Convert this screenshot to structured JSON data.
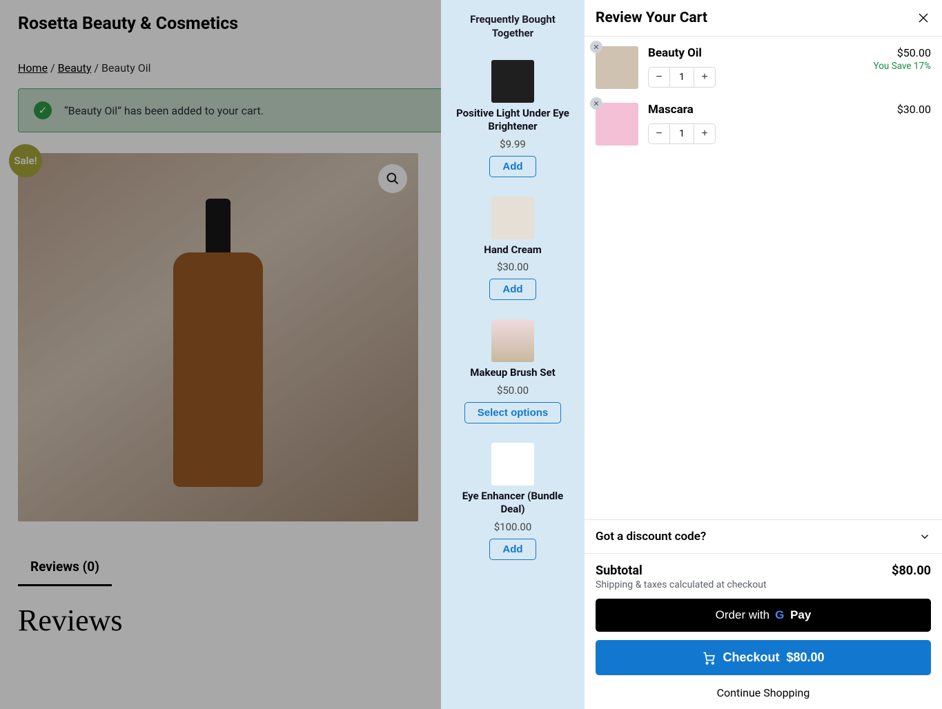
{
  "site": {
    "title": "Rosetta Beauty & Cosmetics"
  },
  "breadcrumb": {
    "home": "Home",
    "sep": "/",
    "beauty": "Beauty",
    "current": "Beauty Oil"
  },
  "alert": {
    "message": "“Beauty Oil” has been added to your cart."
  },
  "sale_badge": "Sale!",
  "reviews_tab": "Reviews (0)",
  "reviews_heading": "Reviews",
  "fbt": {
    "title": "Frequently Bought Together",
    "items": [
      {
        "name": "Positive Light Under Eye Brightener",
        "price": "$9.99",
        "action": "Add"
      },
      {
        "name": "Hand Cream",
        "price": "$30.00",
        "action": "Add"
      },
      {
        "name": "Makeup Brush Set",
        "price": "$50.00",
        "action": "Select options"
      },
      {
        "name": "Eye Enhancer (Bundle Deal)",
        "price": "$100.00",
        "action": "Add"
      }
    ]
  },
  "cart": {
    "title": "Review Your Cart",
    "items": [
      {
        "name": "Beauty Oil",
        "qty": "1",
        "price": "$50.00",
        "save": "You Save 17%"
      },
      {
        "name": "Mascara",
        "qty": "1",
        "price": "$30.00",
        "save": ""
      }
    ],
    "discount_label": "Got a discount code?",
    "subtotal_label": "Subtotal",
    "subtotal_value": "$80.00",
    "ship_note": "Shipping & taxes calculated at checkout",
    "order_with": "Order with",
    "pay_label": "Pay",
    "checkout_label": "Checkout",
    "checkout_total": "$80.00",
    "continue": "Continue Shopping"
  }
}
